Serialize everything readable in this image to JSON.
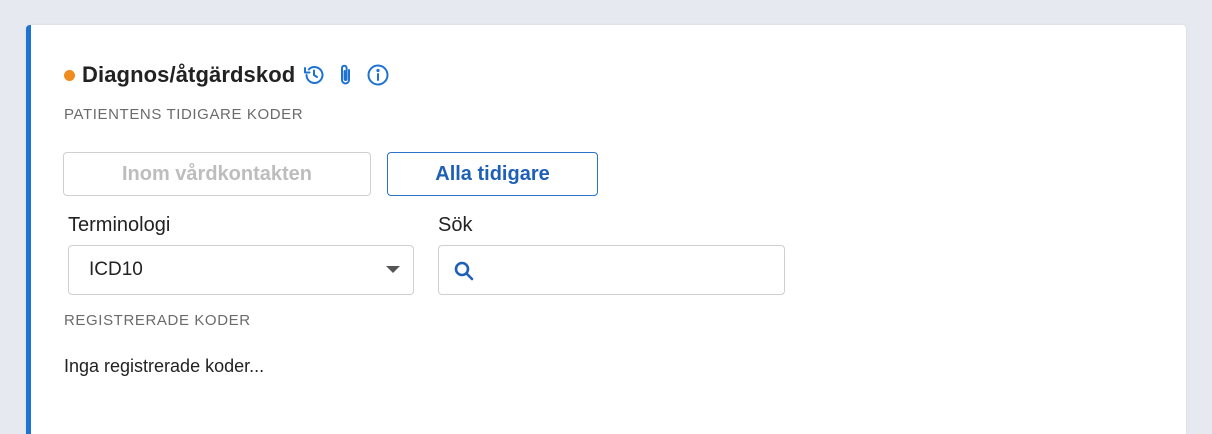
{
  "section": {
    "title": "Diagnos/åtgärdskod",
    "status_dot_color": "#f08c1e",
    "accent_color": "#1e73d2",
    "icons": [
      "history-icon",
      "paperclip-icon",
      "info-icon"
    ]
  },
  "previous_codes": {
    "label": "PATIENTENS TIDIGARE KODER",
    "buttons": {
      "within_contact": "Inom vårdkontakten",
      "all_previous": "Alla tidigare"
    }
  },
  "terminology": {
    "label": "Terminologi",
    "selected": "ICD10"
  },
  "search": {
    "label": "Sök",
    "value": "",
    "placeholder": ""
  },
  "registered": {
    "label": "REGISTRERADE KODER",
    "empty_text": "Inga registrerade koder..."
  }
}
